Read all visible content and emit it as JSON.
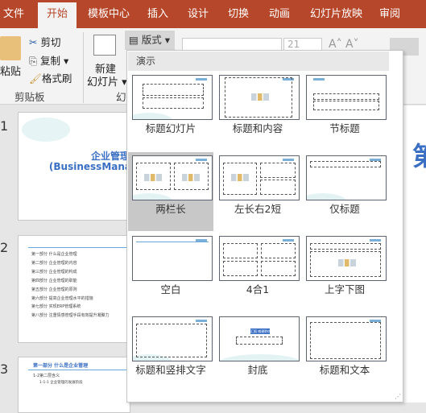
{
  "tabs": [
    "文件",
    "开始",
    "模板中心",
    "插入",
    "设计",
    "切换",
    "动画",
    "幻灯片放映",
    "审阅"
  ],
  "active_tab": "开始",
  "ribbon": {
    "paste": "粘贴",
    "cut": "剪切",
    "copy": "复制",
    "format_painter": "格式刷",
    "clipboard_group": "剪贴板",
    "new_slide_line1": "新建",
    "new_slide_line2": "幻灯片",
    "slides_group": "幻",
    "layout_button": "版式",
    "font_size": "21"
  },
  "panel": {
    "section": "演示",
    "layouts": [
      {
        "label": "标题幻灯片"
      },
      {
        "label": "标题和内容"
      },
      {
        "label": "节标题"
      },
      {
        "label": "两栏长",
        "selected": true
      },
      {
        "label": "左长右2短"
      },
      {
        "label": "仅标题"
      },
      {
        "label": "空白"
      },
      {
        "label": "4合1"
      },
      {
        "label": "上字下图"
      },
      {
        "label": "标题和竖排文字"
      },
      {
        "label": "封底"
      },
      {
        "label": "标题和文本"
      }
    ],
    "cover_badge": "汇报 感谢聆听"
  },
  "slides": [
    {
      "number": "1",
      "title": "企业管理",
      "subtitle": "(BusinessMana"
    },
    {
      "number": "2",
      "items": [
        "第一部分 什么是企业管理",
        "第二部分 企业管理的内容",
        "第三部分 企业管理的构成",
        "第四部分 企业管理的职能",
        "第五部分 企业管理的原则",
        "第六部分 提高企业管理水平的措施",
        "第七部分 实现ERP管理系统",
        "第八部分 注重情感管理手段有效提升凝聚力"
      ]
    },
    {
      "number": "3",
      "title": "第一部分 什么是企业管理",
      "line1": "1-2第二层含义",
      "line2": "1-1-1 企业管理的发展阶段"
    }
  ],
  "main_slide_char": "第",
  "colors": {
    "accent": "#b7472a",
    "title_blue": "#3a6fc4"
  }
}
